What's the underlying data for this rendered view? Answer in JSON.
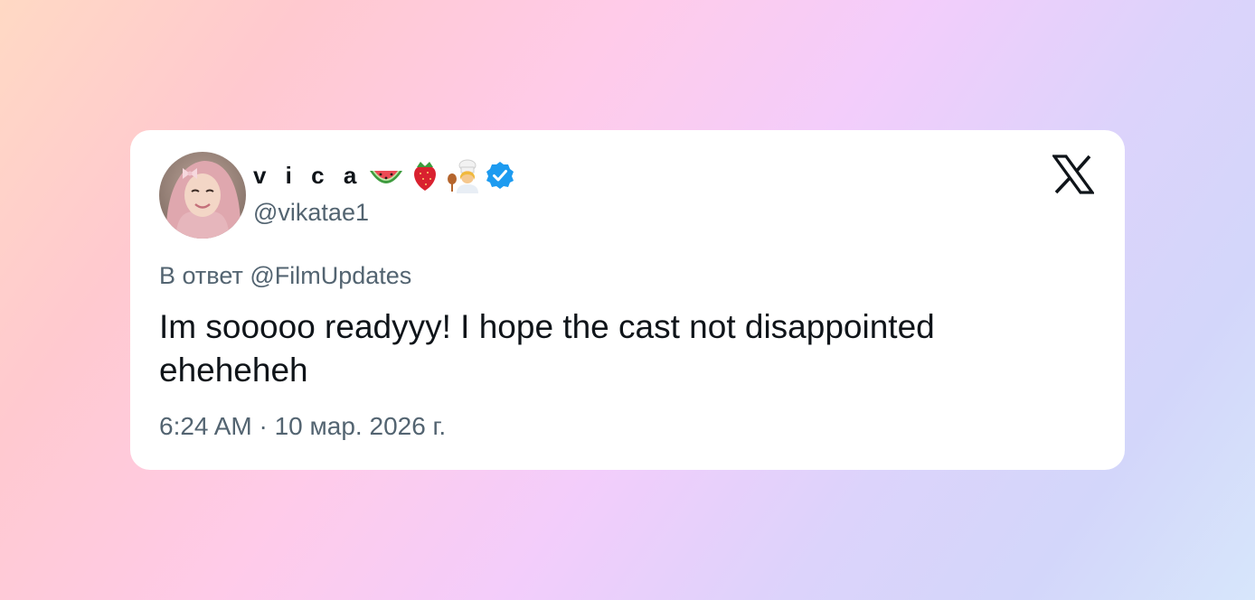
{
  "author": {
    "display_name": "v i c a",
    "emojis": [
      "watermelon-emoji",
      "strawberry-emoji",
      "woman-cook-emoji"
    ],
    "verified": true,
    "handle": "@vikatae1"
  },
  "platform_icon": "x-logo-icon",
  "tweet": {
    "reply_to": "В ответ @FilmUpdates",
    "text": "Im sooooo readyyy! I hope the cast not disappointed eheheheh",
    "timestamp": "6:24 AM · 10 мар. 2026 г."
  },
  "colors": {
    "text_primary": "#0f1419",
    "text_secondary": "#536471",
    "verified_blue": "#1d9bf0"
  }
}
